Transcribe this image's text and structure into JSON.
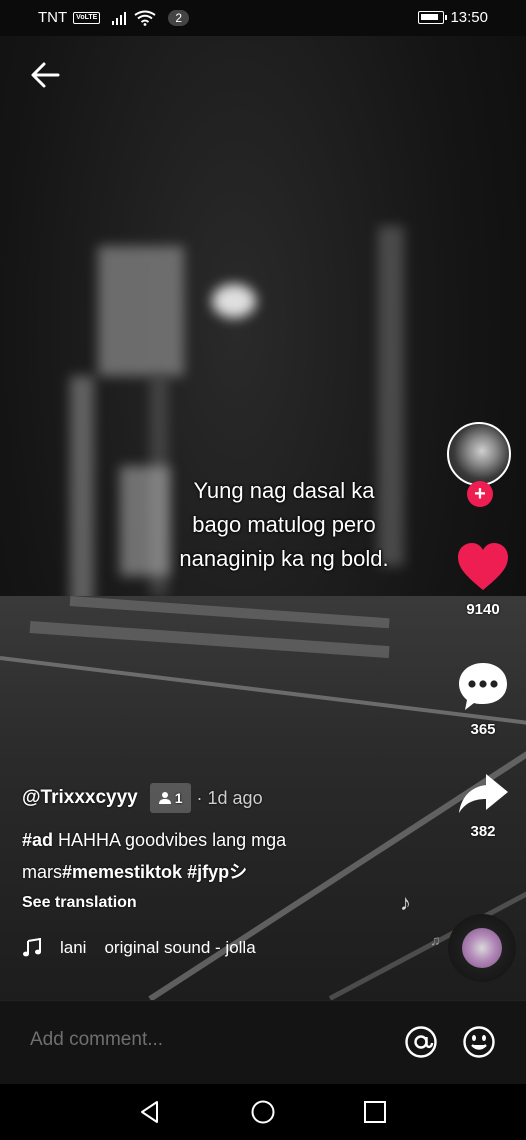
{
  "status_bar": {
    "carrier": "TNT",
    "network_badge": "VoLTE",
    "notification_count": "2",
    "time": "13:50"
  },
  "video": {
    "overlay_lines": [
      "Yung nag dasal ka",
      "bago matulog pero",
      "nanaginip ka ng bold."
    ]
  },
  "actions": {
    "like_count": "9140",
    "comment_count": "365",
    "share_count": "382",
    "follow_symbol": "+",
    "like_color": "#ee1d52"
  },
  "post": {
    "username": "@Trixxxcyyy",
    "friend_count": "1",
    "time_ago": "· 1d ago",
    "caption_tag1": "#ad",
    "caption_mid": " HAHHA goodvibes lang mga",
    "caption_line2_start": "mars",
    "caption_tag2": "#memestiktok",
    "caption_tag3": " #jfypシ",
    "see_translation": "See translation"
  },
  "music": {
    "artist": "lani",
    "sound": "original sound - jolla"
  },
  "comment_bar": {
    "placeholder": "Add comment..."
  },
  "icons": {
    "back": "arrow-left-icon",
    "like": "heart-icon",
    "comment": "speech-bubble-icon",
    "share": "share-arrow-icon",
    "mention": "at-sign-icon",
    "emoji": "smiley-icon",
    "music": "music-note-icon"
  }
}
